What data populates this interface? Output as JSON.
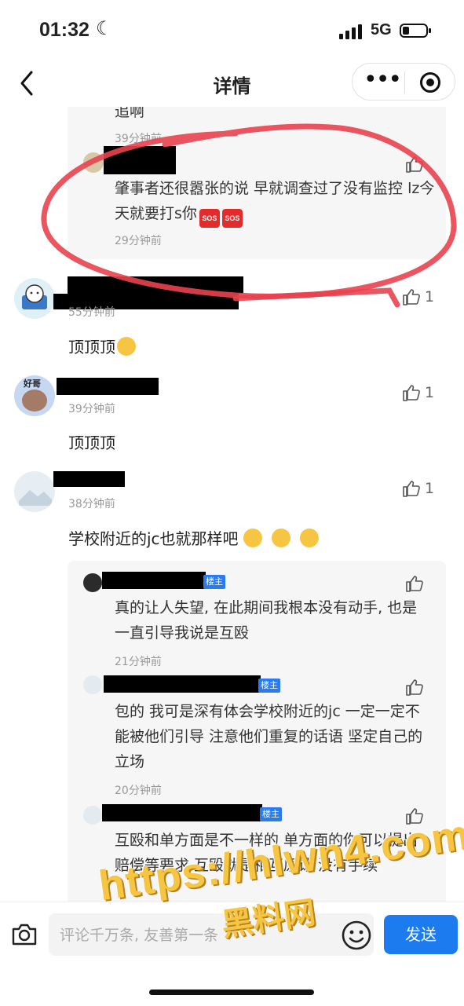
{
  "status_bar": {
    "time": "01:32",
    "network": "5G",
    "moon_icon": "moon-icon",
    "signal_icon": "signal-icon",
    "battery_icon": "battery-icon"
  },
  "nav": {
    "title": "详情",
    "back_icon": "chevron-left-icon",
    "more_icon": "more-icon",
    "target_icon": "target-icon"
  },
  "comments": [
    {
      "top_replies": [
        {
          "text": "追啊",
          "time": "39分钟前"
        },
        {
          "text": "肇事者还很嚣张的说 早就调查过了没有监控 lz今天就要打s你",
          "time": "29分钟前",
          "emoji": [
            "sos-emoji",
            "sos-emoji"
          ]
        }
      ]
    },
    {
      "time": "55分钟前",
      "text": "顶顶顶",
      "likes": "1",
      "emoji": "pleading-face-emoji"
    },
    {
      "time": "39分钟前",
      "text": "顶顶顶",
      "likes": "1",
      "avatar_text": "好哥"
    },
    {
      "time": "38分钟前",
      "text": "学校附近的jc也就那样吧",
      "likes": "1",
      "emoji": [
        "crying-laughing-emoji",
        "crying-laughing-emoji",
        "crying-laughing-emoji"
      ],
      "replies": [
        {
          "badge": "楼主",
          "text": "真的让人失望, 在此期间我根本没有动手, 也是一直引导我说是互殴",
          "time": "21分钟前"
        },
        {
          "badge": "楼主",
          "text": "包的 我可是深有体会学校附近的jc 一定一定不能被他们引导 注意他们重复的话语 坚定自己的立场",
          "time": "20分钟前"
        },
        {
          "badge": "楼主",
          "text": "互殴和单方面是不一样的 单方面的你可以提出赔偿等要求 互殴就是相互原谅 没有手续"
        }
      ]
    }
  ],
  "bottom_bar": {
    "placeholder": "评论千万条, 友善第一条",
    "send_label": "发送",
    "camera_icon": "camera-icon",
    "smile_icon": "smile-icon"
  },
  "watermark": {
    "url": "https://hlwn4.com",
    "site": "黑料网"
  },
  "colors": {
    "accent": "#1c7cef",
    "annotation": "#e8434f",
    "watermark": "#f6c542"
  }
}
